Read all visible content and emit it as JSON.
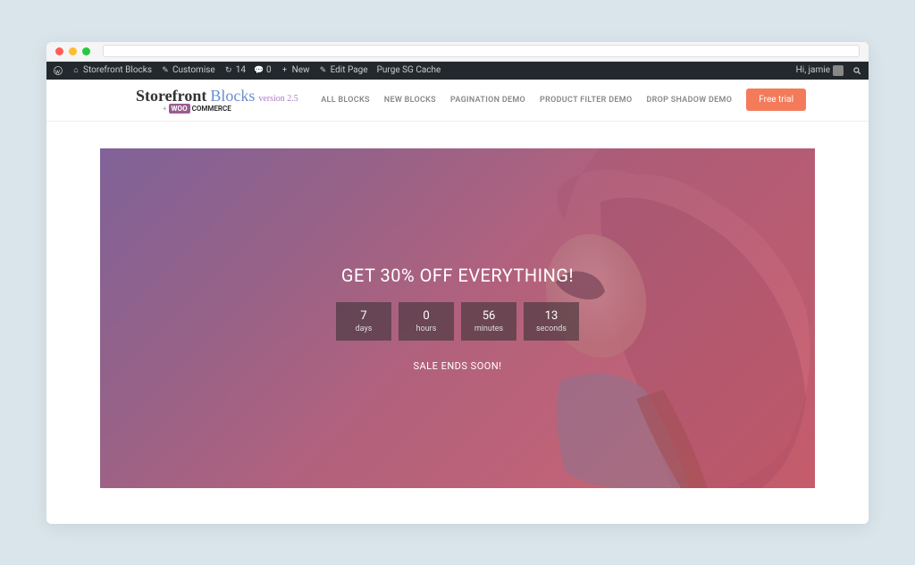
{
  "adminbar": {
    "site_name": "Storefront Blocks",
    "customise": "Customise",
    "updates_count": "14",
    "comments_count": "0",
    "new": "New",
    "edit_page": "Edit Page",
    "purge_cache": "Purge SG Cache",
    "greeting": "Hi, jamie"
  },
  "logo": {
    "storefront": "Storefront",
    "blocks": "Blocks",
    "version": "version 2.5",
    "woo": "WOO",
    "commerce": "COMMERCE"
  },
  "nav": {
    "items": [
      {
        "label": "ALL BLOCKS"
      },
      {
        "label": "NEW BLOCKS"
      },
      {
        "label": "PAGINATION DEMO"
      },
      {
        "label": "PRODUCT FILTER DEMO"
      },
      {
        "label": "DROP SHADOW DEMO"
      }
    ],
    "cta": "Free trial"
  },
  "hero": {
    "heading": "GET 30% OFF EVERYTHING!",
    "subtext": "SALE ENDS SOON!",
    "countdown": [
      {
        "value": "7",
        "label": "days"
      },
      {
        "value": "0",
        "label": "hours"
      },
      {
        "value": "56",
        "label": "minutes"
      },
      {
        "value": "13",
        "label": "seconds"
      }
    ]
  }
}
